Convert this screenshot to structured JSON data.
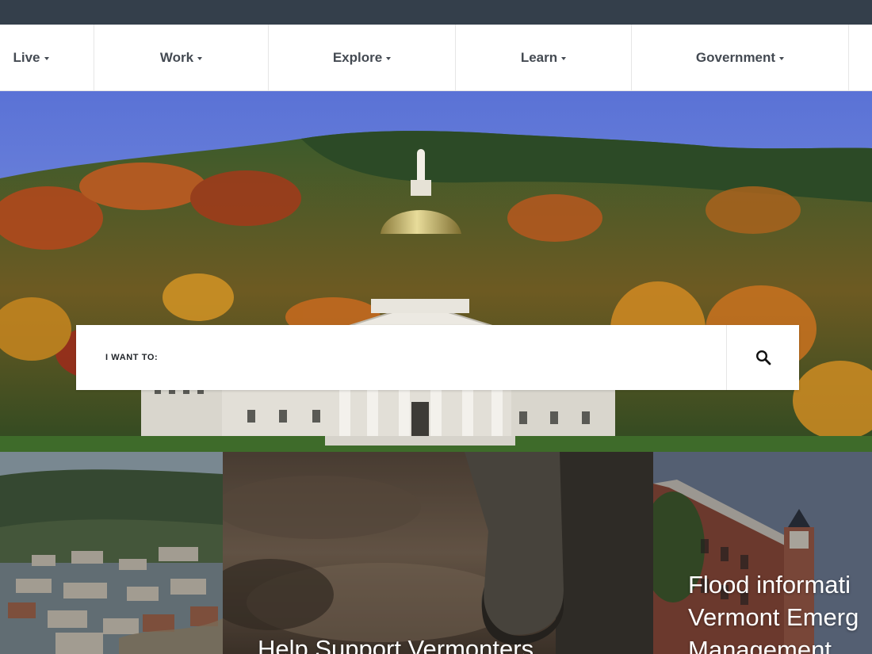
{
  "nav": {
    "items": [
      {
        "label": "Live"
      },
      {
        "label": "Work"
      },
      {
        "label": "Explore"
      },
      {
        "label": "Learn"
      },
      {
        "label": "Government"
      }
    ]
  },
  "search": {
    "label": "I WANT TO:",
    "value": "",
    "icon": "search-icon"
  },
  "hero": {
    "image": "vermont-state-house-autumn-hillside"
  },
  "tiles": [
    {
      "title": "",
      "image": "flooded-town-aerial"
    },
    {
      "title_lines": [
        "Help Support Vermonters"
      ],
      "image": "muddy-boot"
    },
    {
      "title_lines": [
        "Flood informati",
        "Vermont Emerg",
        "Management"
      ],
      "image": "brick-building-clocktower"
    }
  ],
  "colors": {
    "topbar": "#343f4b",
    "nav_text": "#444a52",
    "search_label": "#1f2328"
  }
}
